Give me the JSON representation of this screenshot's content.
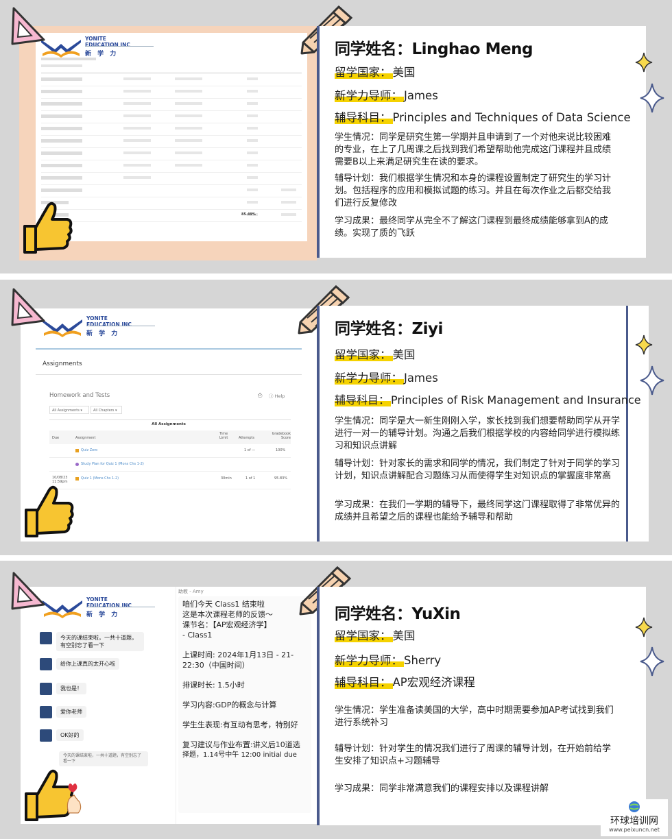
{
  "cases": [
    {
      "name": "同学姓名：Linghao Meng",
      "country_label": "留学国家：",
      "country": "美国",
      "tutor_label": "新学力导师：",
      "tutor": "James",
      "subject_label": "辅导科目：",
      "subject": "Principles and Techniques of Data Science",
      "situation": "学生情况：同学是研究生第一学期并且申请到了一个对他来说比较困难的专业，在上了几周课之后找到我们希望帮助他完成这门课程并且成绩需要B以上来满足研究生在读的要求。",
      "plan": "辅导计划：我们根据学生情况和本身的课程设置制定了研究生的学习计划。包括程序的应用和模拟试题的练习。并且在每次作业之后都交给我们进行反复修改",
      "result": "学习成果：最终同学从完全不了解这门课程到最终成绩能够拿到A的成绩。实现了质的飞跃"
    },
    {
      "name": "同学姓名：Ziyi",
      "country_label": "留学国家：",
      "country": "美国",
      "tutor_label": "新学力导师：",
      "tutor": "James",
      "subject_label": "辅导科目：",
      "subject": "Principles of Risk Management and Insurance",
      "situation": "学生情况：同学是大一新生刚刚入学，家长找到我们想要帮助同学从开学进行一对一的辅导计划。沟通之后我们根据学校的内容给同学进行模拟练习和知识点讲解",
      "plan": "辅导计划：针对家长的需求和同学的情况，我们制定了针对于同学的学习计划，知识点讲解配合习题练习从而使得学生对知识点的掌握度非常高",
      "result": "学习成果：在我们一学期的辅导下，最终同学这门课程取得了非常优异的成绩并且希望之后的课程也能给予辅导和帮助"
    },
    {
      "name": "同学姓名：YuXin",
      "country_label": "留学国家：",
      "country": "美国",
      "tutor_label": "新学力导师：",
      "tutor": "Sherry",
      "subject_label": "辅导科目：",
      "subject": "AP宏观经济课程",
      "situation": "学生情况：学生准备读美国的大学，高中时期需要参加AP考试找到我们进行系统补习",
      "plan": "辅导计划：针对学生的情况我们进行了周课的辅导计划，在开始前给学生安排了知识点+习题辅导",
      "result": "学习成果：同学非常满意我们的课程安排以及课程讲解"
    }
  ],
  "logo": {
    "line1": "YONITE",
    "line2": "EDUCATION INC",
    "cn": "新 学 力"
  },
  "grades": {
    "percent": "85.49%"
  },
  "assignments": {
    "title": "Assignments",
    "section": "Homework and Tests",
    "help": "Help",
    "filter1": "All Assignments",
    "filter2": "All Chapters",
    "table_title": "All Assignments",
    "headers": [
      "Due",
      "Assignment",
      "Time Limit",
      "Attempts",
      "Gradebook Score"
    ],
    "rows": [
      {
        "due": "",
        "name": "Quiz Zero",
        "limit": "",
        "attempts": "1 of —",
        "score": "100%"
      },
      {
        "due": "",
        "name": "Study Plan for Quiz 1 (Mons Chs 1-2)",
        "limit": "",
        "attempts": "",
        "score": ""
      },
      {
        "due": "10/08/23 11:59pm",
        "name": "Quiz 1 (Mons Chs 1-2)",
        "limit": "30min",
        "attempts": "1 of 1",
        "score": "95.83%"
      }
    ]
  },
  "chat": {
    "left": [
      "今天的课结束啦，一共十道题，有空别忘了看一下",
      "给你上课真的太开心啦",
      "我也是！",
      "爱你老师",
      "OK好的",
      "今天的课结束啦，一共十道题，有空别忘了看一下"
    ],
    "sender": "助教 - Amy",
    "msg_lines": [
      "咱们今天 Class1 结束啦",
      "这是本次课程老师的反馈～",
      "课节名：【AP宏观经济学】",
      " - Class1",
      "上课时间: 2024年1月13日 - 21-",
      "22:30（中国时间）",
      "排课时长: 1.5小时",
      "学习内容:GDP的概念与计算",
      "学生生表现:有互动有思考，特别好",
      "复习建议与作业布置:讲义后10道选",
      "择题，1.14号中午 12:00 initial due"
    ]
  },
  "watermark": {
    "cn": "环球培训网",
    "url": "www.peixuncn.net"
  },
  "colors": {
    "panel_bg": "#d6d6d6",
    "accent_blue": "#4a5a8c",
    "highlight_yellow": "#f5d200",
    "frame_peach": "#f6d4bb"
  }
}
